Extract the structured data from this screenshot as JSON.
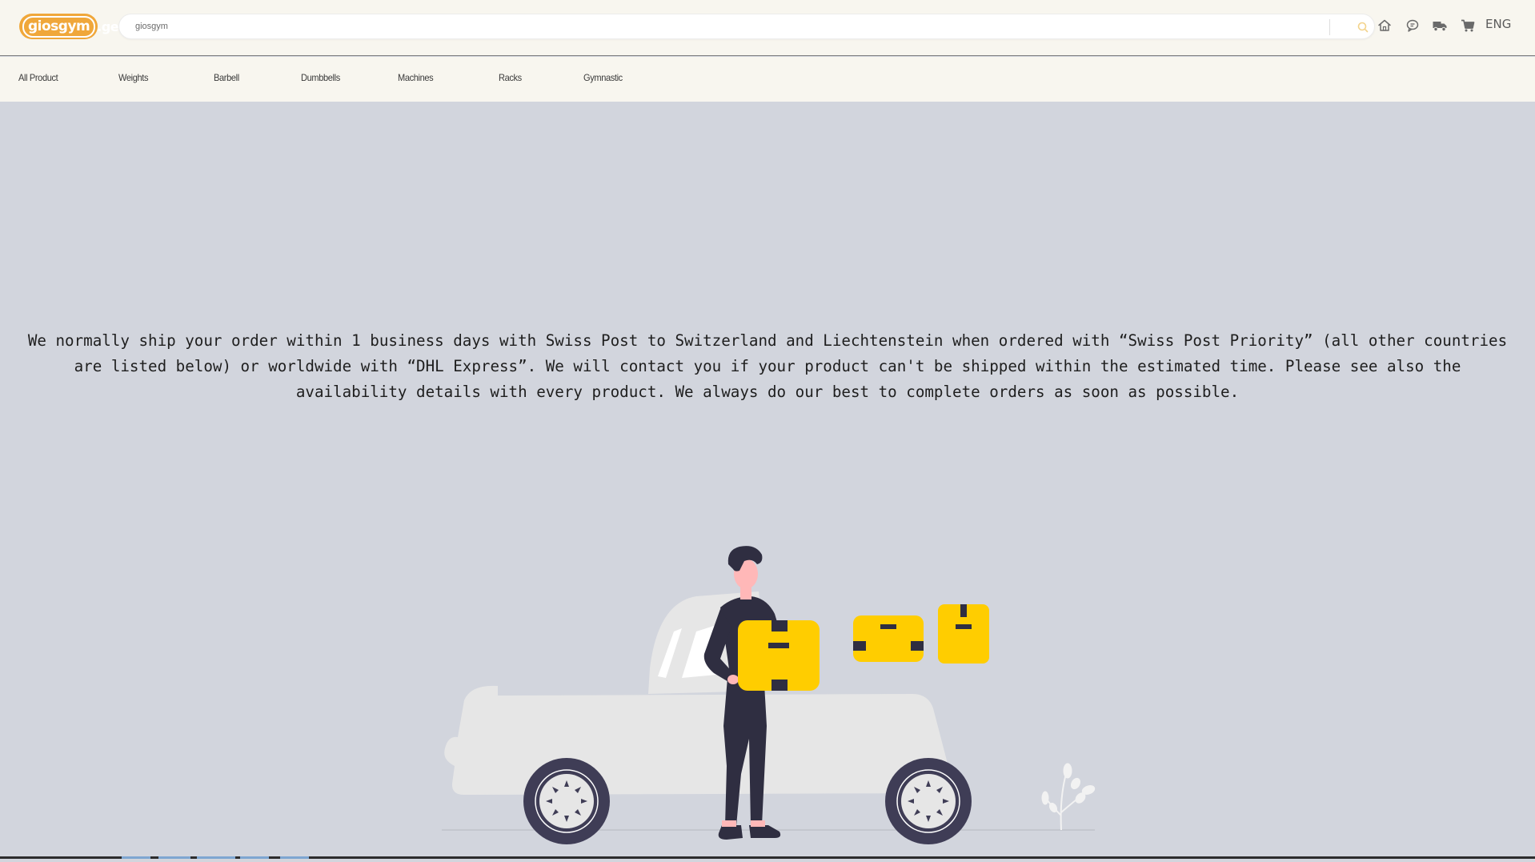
{
  "header": {
    "logo": {
      "main": "giosgym",
      "suffix": ".ge"
    },
    "search": {
      "value": "giosgym",
      "placeholder": ""
    },
    "icons": [
      "home-icon",
      "chat-icon",
      "delivery-truck-icon",
      "cart-icon"
    ],
    "language": "ENG"
  },
  "categories": [
    "All Product",
    "Weights",
    "Barbell",
    "Dumbbells",
    "Machines",
    "Racks",
    "Gymnastic"
  ],
  "main": {
    "shipping_text": "We normally ship your order within 1 business days with Swiss Post to Switzerland and Liechtenstein when ordered with “Swiss Post Priority” (all other countries are listed below) or worldwide with “DHL Express”. We will contact you if your product can't be shipped within the estimated time. Please see also the availability details with every product. We always do our best to complete orders as soon as possible."
  },
  "colors": {
    "brand": "#f0a73a",
    "header_bg": "#f8f6ef",
    "page_bg": "#d2d5dd",
    "box_yellow": "#ffcd00",
    "person_dark": "#2f2e41",
    "skin": "#fbbebe",
    "car": "#e6e6e6"
  }
}
